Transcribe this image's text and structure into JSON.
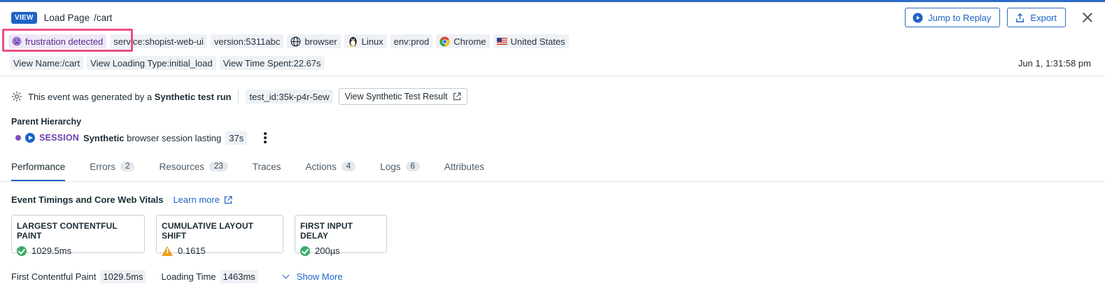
{
  "header": {
    "badge": "VIEW",
    "title": "Load Page",
    "path": "/cart",
    "jump_to_replay": "Jump to Replay",
    "export": "Export"
  },
  "tags": {
    "frustration": "frustration detected",
    "service": "service:shopist-web-ui",
    "version": "version:5311abc",
    "browser_src": "browser",
    "os": "Linux",
    "env": "env:prod",
    "browser": "Chrome",
    "country": "United States"
  },
  "view_attrs": {
    "name": "View Name:/cart",
    "loading_type": "View Loading Type:initial_load",
    "time_spent": "View Time Spent:22.67s"
  },
  "date": "Jun 1, 1:31:58 pm",
  "synthetic": {
    "prefix": "This event was generated by a ",
    "bold": "Synthetic test run",
    "test_id": "test_id:35k-p4r-5ew",
    "button": "View Synthetic Test Result"
  },
  "parent_hierarchy": {
    "label": "Parent Hierarchy",
    "session": "SESSION",
    "bold": "Synthetic",
    "text": "browser session lasting",
    "duration": "37s"
  },
  "tabs": [
    {
      "label": "Performance",
      "count": ""
    },
    {
      "label": "Errors",
      "count": "2"
    },
    {
      "label": "Resources",
      "count": "23"
    },
    {
      "label": "Traces",
      "count": ""
    },
    {
      "label": "Actions",
      "count": "4"
    },
    {
      "label": "Logs",
      "count": "6"
    },
    {
      "label": "Attributes",
      "count": ""
    }
  ],
  "vitals_section": {
    "title": "Event Timings and Core Web Vitals",
    "learn_more": "Learn more",
    "items": [
      {
        "label": "LARGEST CONTENTFUL PAINT",
        "value": "1029.5ms",
        "status": "ok"
      },
      {
        "label": "CUMULATIVE LAYOUT SHIFT",
        "value": "0.1615",
        "status": "warning"
      },
      {
        "label": "FIRST INPUT DELAY",
        "value": "200µs",
        "status": "ok"
      }
    ]
  },
  "timings": {
    "fcp_label": "First Contentful Paint",
    "fcp_value": "1029.5ms",
    "lt_label": "Loading Time",
    "lt_value": "1463ms",
    "show_more": "Show More"
  },
  "colors": {
    "accent": "#1e63c6",
    "highlight": "#ee4f8a",
    "session": "#6b3fb0"
  }
}
